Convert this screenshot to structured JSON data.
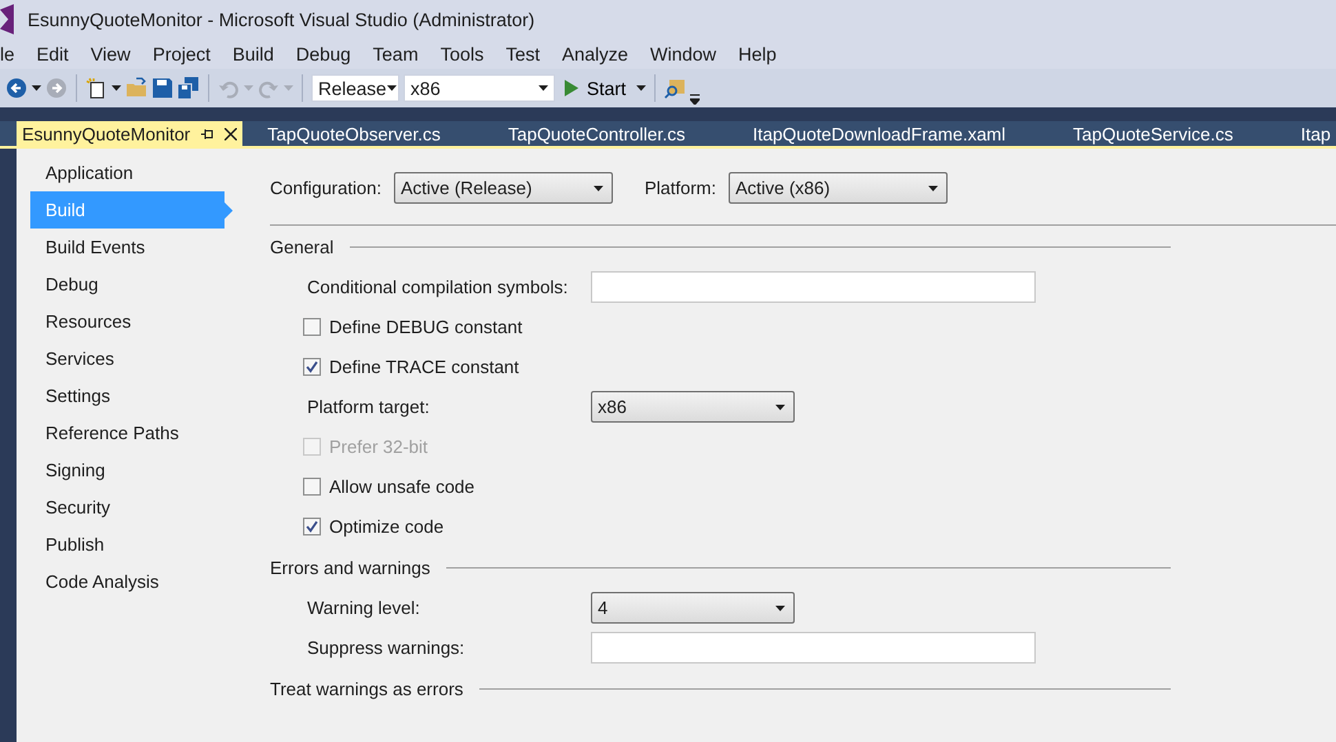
{
  "window": {
    "title": "EsunnyQuoteMonitor - Microsoft Visual Studio (Administrator)"
  },
  "menu": [
    "le",
    "Edit",
    "View",
    "Project",
    "Build",
    "Debug",
    "Team",
    "Tools",
    "Test",
    "Analyze",
    "Window",
    "Help"
  ],
  "toolbar": {
    "configuration": "Release",
    "platform": "x86",
    "start": "Start"
  },
  "tabs": [
    {
      "label": "EsunnyQuoteMonitor",
      "selected": true
    },
    {
      "label": "TapQuoteObserver.cs",
      "selected": false
    },
    {
      "label": "TapQuoteController.cs",
      "selected": false
    },
    {
      "label": "ItapQuoteDownloadFrame.xaml",
      "selected": false
    },
    {
      "label": "TapQuoteService.cs",
      "selected": false
    },
    {
      "label": "Itap",
      "selected": false
    }
  ],
  "sidebar": {
    "items": [
      {
        "label": "Application",
        "selected": false
      },
      {
        "label": "Build",
        "selected": true
      },
      {
        "label": "Build Events",
        "selected": false
      },
      {
        "label": "Debug",
        "selected": false
      },
      {
        "label": "Resources",
        "selected": false
      },
      {
        "label": "Services",
        "selected": false
      },
      {
        "label": "Settings",
        "selected": false
      },
      {
        "label": "Reference Paths",
        "selected": false
      },
      {
        "label": "Signing",
        "selected": false
      },
      {
        "label": "Security",
        "selected": false
      },
      {
        "label": "Publish",
        "selected": false
      },
      {
        "label": "Code Analysis",
        "selected": false
      }
    ]
  },
  "header": {
    "configuration_label": "Configuration:",
    "configuration": "Active (Release)",
    "platform_label": "Platform:",
    "platform": "Active (x86)"
  },
  "sections": [
    {
      "title": "General",
      "rows": [
        {
          "kind": "text",
          "label": "Conditional compilation symbols:"
        },
        {
          "kind": "checkbox",
          "label": "Define DEBUG constant",
          "checked": false,
          "disabled": false
        },
        {
          "kind": "checkbox",
          "label": "Define TRACE constant",
          "checked": true,
          "disabled": false
        },
        {
          "kind": "select",
          "label": "Platform target:",
          "value": "x86"
        },
        {
          "kind": "checkbox",
          "label": "Prefer 32-bit",
          "checked": false,
          "disabled": true
        },
        {
          "kind": "checkbox",
          "label": "Allow unsafe code",
          "checked": false,
          "disabled": false
        },
        {
          "kind": "checkbox",
          "label": "Optimize code",
          "checked": true,
          "disabled": false
        }
      ]
    },
    {
      "title": "Errors and warnings",
      "rows": [
        {
          "kind": "select",
          "label": "Warning level:",
          "value": "4"
        },
        {
          "kind": "text",
          "label": "Suppress warnings:"
        }
      ]
    },
    {
      "title": "Treat warnings as errors"
    }
  ]
}
